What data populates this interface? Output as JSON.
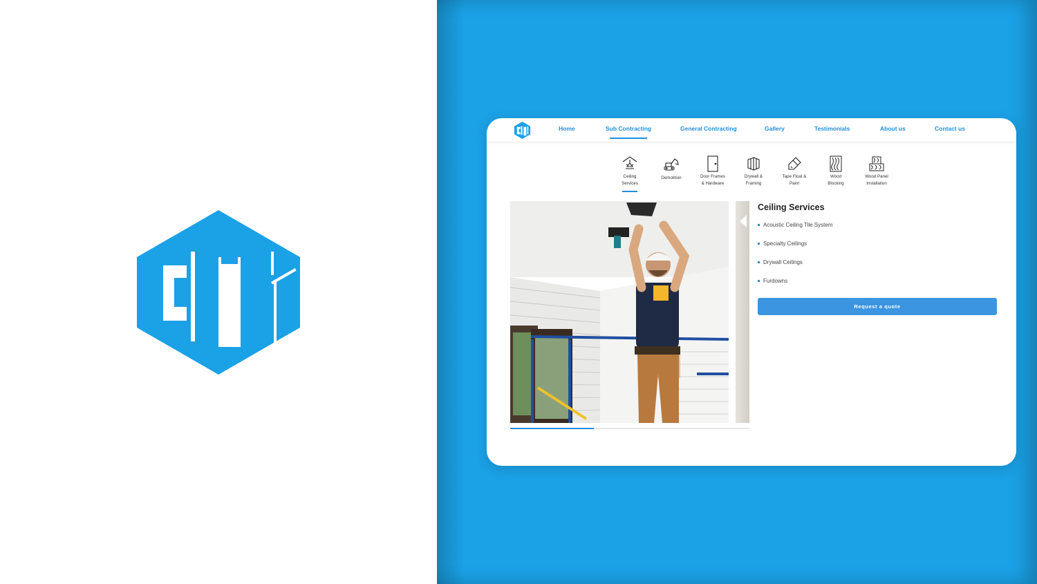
{
  "brand": {
    "logo_text": "CCi",
    "color": "#1ba1e6"
  },
  "nav": {
    "items": [
      {
        "label": "Home",
        "active": false
      },
      {
        "label": "Sub Contracting",
        "active": true
      },
      {
        "label": "General Contracting",
        "active": false
      },
      {
        "label": "Gallery",
        "active": false
      },
      {
        "label": "Testimonials",
        "active": false
      },
      {
        "label": "About us",
        "active": false
      },
      {
        "label": "Contact us",
        "active": false
      }
    ]
  },
  "services": [
    {
      "line1": "Ceiling",
      "line2": "Services",
      "icon": "ceiling-light-icon",
      "active": true
    },
    {
      "line1": "Demolition",
      "line2": "",
      "icon": "excavator-icon",
      "active": false
    },
    {
      "line1": "Door Frames",
      "line2": "& Hardware",
      "icon": "door-icon",
      "active": false
    },
    {
      "line1": "Drywall &",
      "line2": "Framing",
      "icon": "drywall-icon",
      "active": false
    },
    {
      "line1": "Tape Float &",
      "line2": "Paint",
      "icon": "paint-brush-icon",
      "active": false
    },
    {
      "line1": "Wood",
      "line2": "Blocking",
      "icon": "wood-grain-icon",
      "active": false
    },
    {
      "line1": "Wood Panel",
      "line2": "Installation",
      "icon": "wood-panels-icon",
      "active": false
    }
  ],
  "detail": {
    "title": "Ceiling Services",
    "items": [
      "Acoustic Ceiling Tile System",
      "Specialty Ceilings",
      "Drywall Ceilings",
      "Furdowns"
    ],
    "button_label": "Request a quote"
  },
  "slider": {
    "progress": 0.35
  },
  "colors": {
    "accent": "#1e8fdb",
    "panel": "#1ba1e6",
    "button": "#3b95e0"
  }
}
